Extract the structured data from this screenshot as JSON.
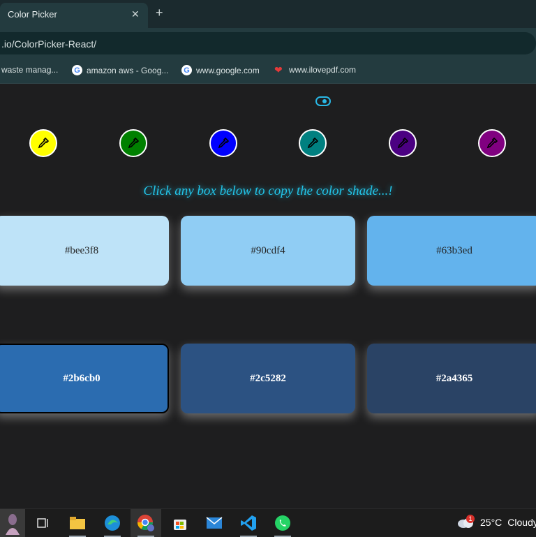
{
  "browser": {
    "tab_title": "Color Picker",
    "close_glyph": "✕",
    "new_tab_glyph": "+",
    "address": ".io/ColorPicker-React/",
    "bookmarks": [
      {
        "label": "waste manag...",
        "icon": "none"
      },
      {
        "label": "amazon aws - Goog...",
        "icon": "google-icon"
      },
      {
        "label": "www.google.com",
        "icon": "google-icon"
      },
      {
        "label": "www.ilovepdf.com",
        "icon": "heart-icon"
      }
    ]
  },
  "app": {
    "swatch_colors": [
      "#ffff00",
      "#008000",
      "#0000ff",
      "#008080",
      "#4b0082",
      "#800080"
    ],
    "heading": "Click any box below to copy the color shade...!",
    "shades": [
      {
        "hex": "#bee3f8",
        "label": "#bee3f8"
      },
      {
        "hex": "#90cdf4",
        "label": "#90cdf4"
      },
      {
        "hex": "#63b3ed",
        "label": "#63b3ed"
      },
      {
        "hex": "#2b6cb0",
        "label": "#2b6cb0"
      },
      {
        "hex": "#2c5282",
        "label": "#2c5282"
      },
      {
        "hex": "#2a4365",
        "label": "#2a4365"
      }
    ]
  },
  "taskbar": {
    "weather_badge": "1",
    "temperature": "25°C",
    "condition": "Cloudy"
  }
}
